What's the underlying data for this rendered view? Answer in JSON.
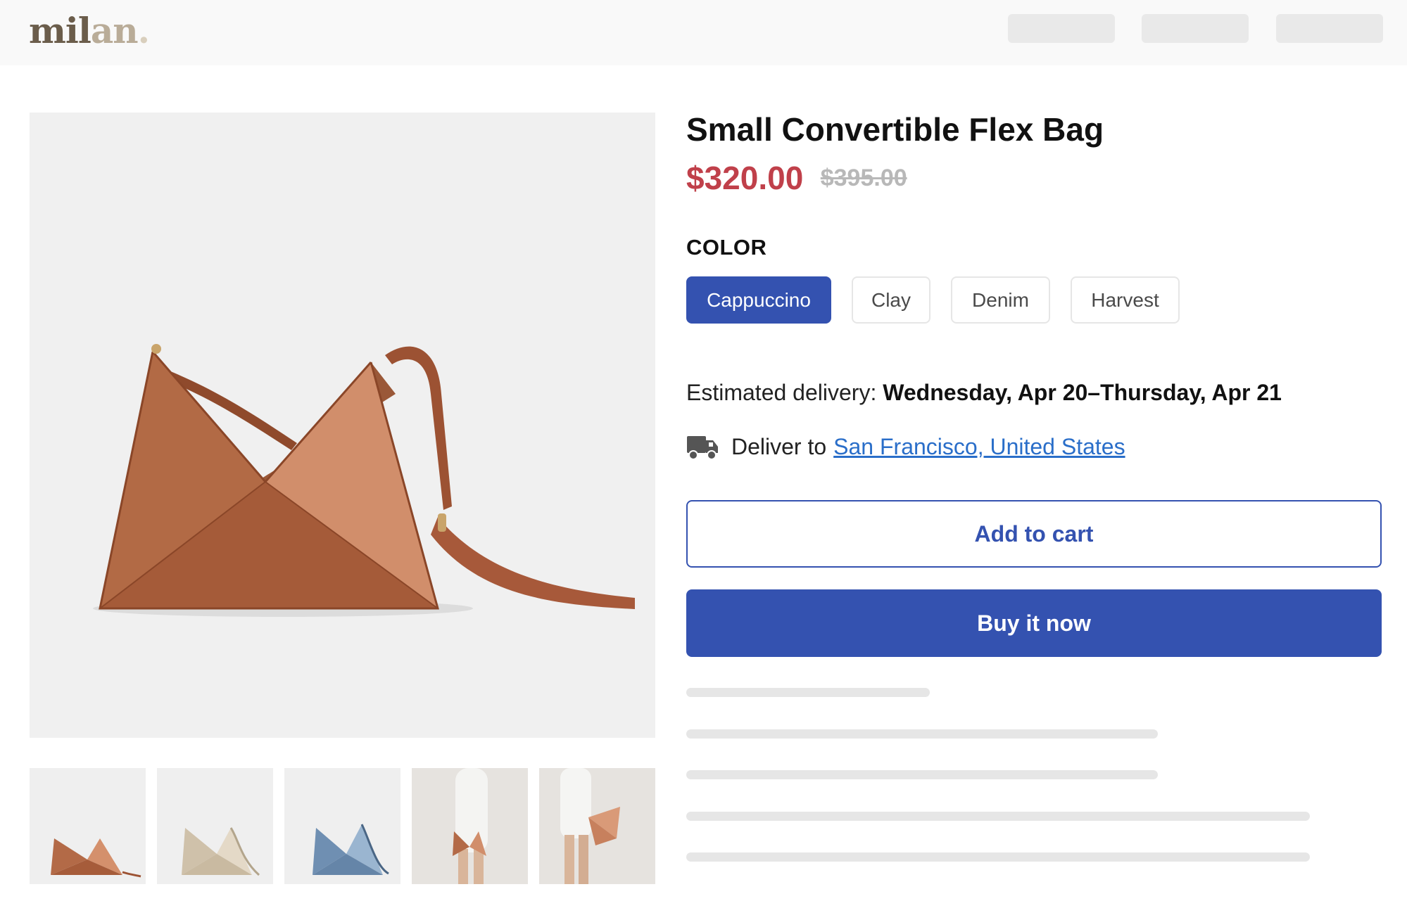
{
  "header": {
    "logo": {
      "part1": "mil",
      "part2": "an",
      "dot": "."
    }
  },
  "product": {
    "title": "Small Convertible Flex Bag",
    "price": "$320.00",
    "original_price": "$395.00",
    "color_label": "COLOR",
    "colors": [
      "Cappuccino",
      "Clay",
      "Denim",
      "Harvest"
    ],
    "selected_color": "Cappuccino",
    "image_subject": "leather convertible triangle bag",
    "thumbnails": [
      "bag-cappuccino",
      "bag-clay",
      "bag-denim",
      "model-carrying-bag-shoulder",
      "model-carrying-bag-hand"
    ]
  },
  "delivery": {
    "estimate_prefix": "Estimated delivery: ",
    "estimate_dates": "Wednesday, Apr 20–Thursday, Apr 21",
    "deliver_to_label": "Deliver to",
    "location": "San Francisco, United States",
    "icon": "truck-icon"
  },
  "actions": {
    "add_to_cart": "Add to cart",
    "buy_now": "Buy it now"
  },
  "colors": {
    "primary": "#3452b0",
    "sale_price": "#c0404a",
    "link": "#2a6ec9",
    "bag_cappuccino": "#b76a45",
    "bag_clay": "#d8cbb6",
    "bag_denim": "#7d9cbd"
  }
}
